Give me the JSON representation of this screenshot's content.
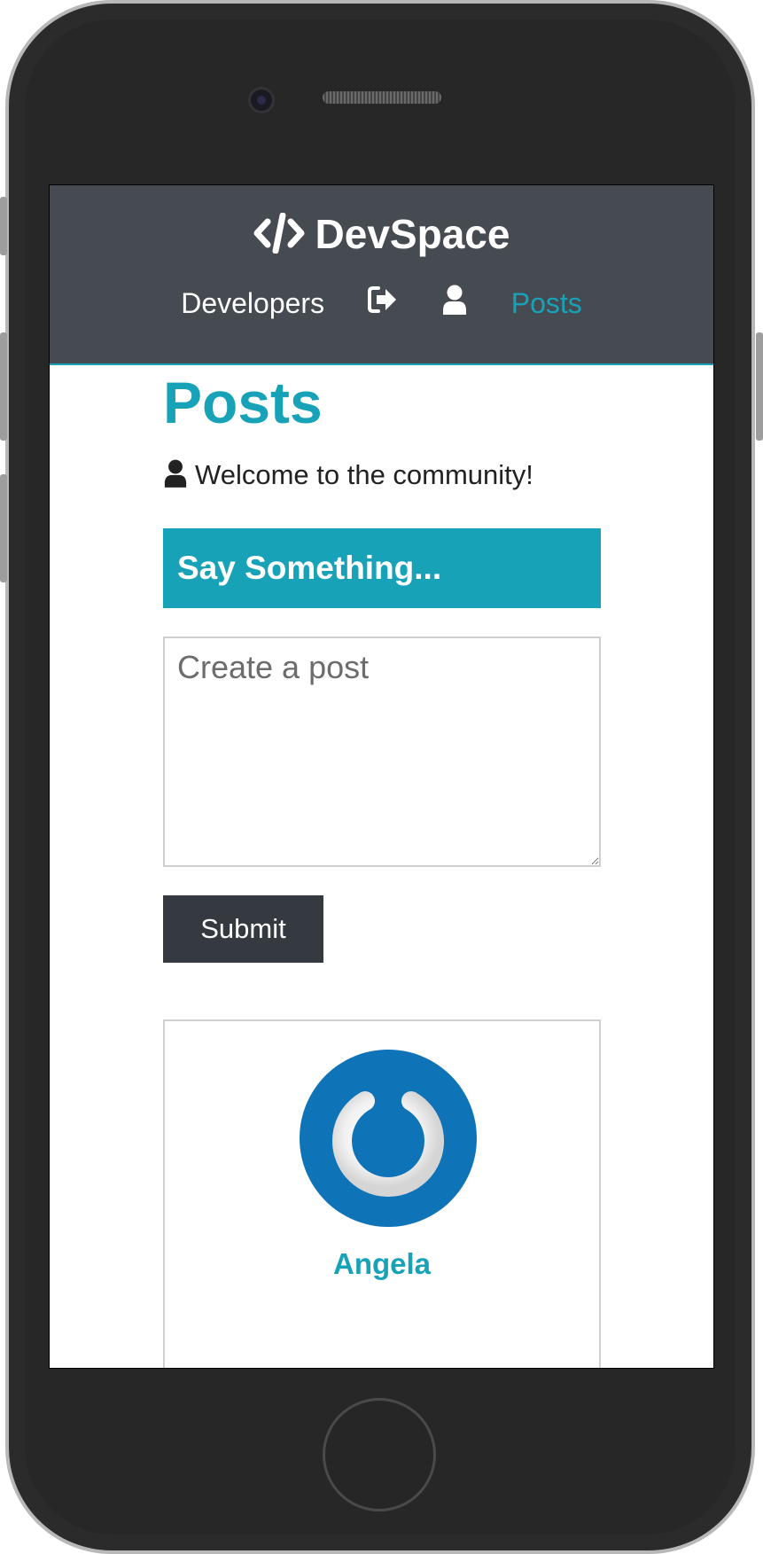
{
  "navbar": {
    "brand": "DevSpace",
    "brand_icon": "code-icon",
    "links": [
      {
        "label": "Developers"
      },
      {
        "icon": "sign-out-icon"
      },
      {
        "icon": "user-icon"
      },
      {
        "label": "Posts"
      }
    ]
  },
  "main": {
    "title": "Posts",
    "lead_icon": "user-icon",
    "lead_text": "Welcome to the community!",
    "form_header": "Say Something...",
    "textarea_placeholder": "Create a post",
    "submit_label": "Submit"
  },
  "posts": [
    {
      "author": "Angela",
      "avatar_icon": "gravatar-logo"
    }
  ],
  "colors": {
    "accent": "#17a2b8",
    "navbar_bg": "#464b52",
    "button_dark": "#343a40",
    "gravatar_blue": "#0f73b8"
  }
}
